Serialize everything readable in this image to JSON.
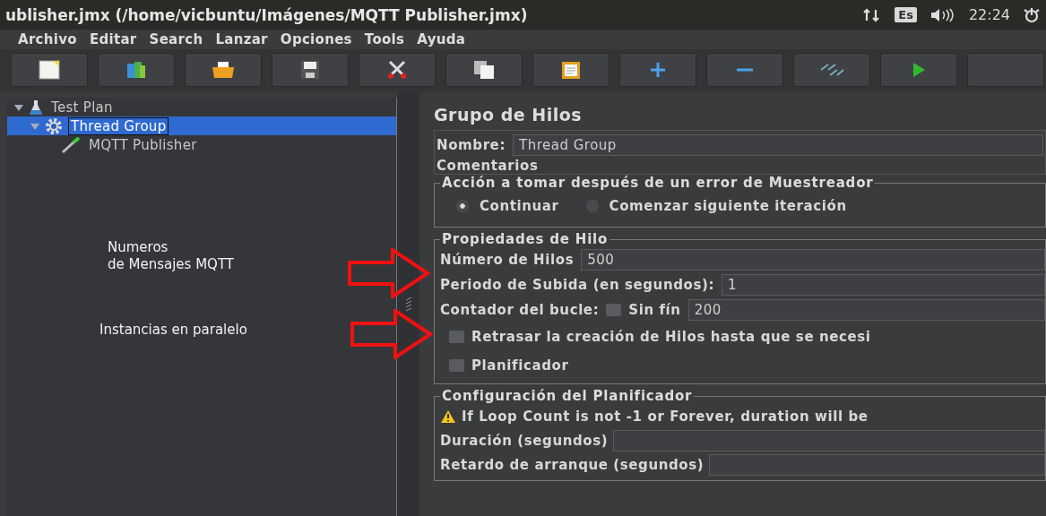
{
  "window": {
    "title": "ublisher.jmx (/home/vicbuntu/Imágenes/MQTT Publisher.jmx)"
  },
  "system_tray": {
    "keyboard": "Es",
    "clock": "22:24"
  },
  "menu": [
    "Archivo",
    "Editar",
    "Search",
    "Lanzar",
    "Opciones",
    "Tools",
    "Ayuda"
  ],
  "toolbar": [
    {
      "kind": "new"
    },
    {
      "kind": "templates"
    },
    {
      "kind": "open"
    },
    {
      "kind": "save"
    },
    {
      "kind": "cut"
    },
    {
      "kind": "copy"
    },
    {
      "kind": "paste"
    },
    {
      "kind": "expand"
    },
    {
      "kind": "collapse"
    },
    {
      "kind": "toggle"
    },
    {
      "kind": "start"
    },
    {
      "kind": "blank"
    }
  ],
  "tree": [
    {
      "label": "Test Plan",
      "kind": "plan",
      "expanded": true,
      "selected": false,
      "children": [
        {
          "label": "Thread Group",
          "kind": "group",
          "expanded": true,
          "selected": true,
          "children": [
            {
              "label": "MQTT Publisher",
              "kind": "sampler",
              "selected": false
            }
          ]
        }
      ]
    }
  ],
  "annotations": [
    {
      "text": "Numeros\nde Mensajes MQTT"
    },
    {
      "text": "Instancias en paralelo"
    }
  ],
  "panel": {
    "title": "Grupo de Hilos",
    "name_label": "Nombre:",
    "name_value": "Thread Group",
    "comments_label": "Comentarios",
    "error_action": {
      "title": "Acción a tomar después de un error de Muestreador",
      "options": [
        {
          "label": "Continuar",
          "selected": true
        },
        {
          "label": "Comenzar siguiente iteración",
          "selected": false
        }
      ]
    },
    "thread_properties": {
      "title": "Propiedades de Hilo",
      "threads_label": "Número de Hilos",
      "threads_value": "500",
      "rampup_label": "Periodo de Subida (en segundos):",
      "rampup_value": "1",
      "loop_label": "Contador del bucle:",
      "forever_label": "Sin fín",
      "forever_checked": false,
      "loop_value": "200",
      "delay_label": "Retrasar la creación de Hilos hasta que se necesi",
      "delay_checked": false,
      "scheduler_label": "Planificador",
      "scheduler_checked": false
    },
    "scheduler_config": {
      "title": "Configuración del Planificador",
      "warning": "If Loop Count is not -1 or Forever, duration will be",
      "duration_label": "Duración (segundos)",
      "startup_label": "Retardo de arranque (segundos)"
    }
  }
}
